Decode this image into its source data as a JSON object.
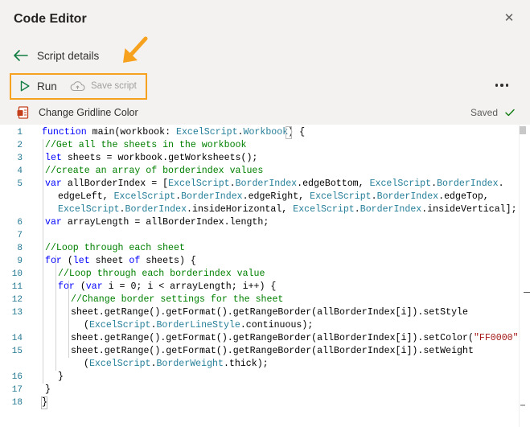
{
  "header": {
    "title": "Code Editor",
    "close_icon": "close-icon"
  },
  "nav": {
    "back_label": "Script details",
    "back_icon": "arrow-left-icon"
  },
  "toolbar": {
    "run_label": "Run",
    "run_icon": "play-icon",
    "save_label": "Save script",
    "save_icon": "cloud-icon",
    "more_icon": "more-horizontal-icon",
    "highlight_color": "#f6a21e"
  },
  "file": {
    "name": "Change Gridline Color",
    "icon": "script-file-icon",
    "status": "Saved",
    "status_icon": "checkmark-icon"
  },
  "colors": {
    "keyword": "#0000ff",
    "comment": "#008000",
    "type": "#267f99",
    "string": "#a31515",
    "line_number": "#237893",
    "check": "#107c10",
    "file_icon": "#c43e1c"
  },
  "editor": {
    "line_numbers": [
      "1",
      "2",
      "3",
      "4",
      "5",
      "",
      "",
      "6",
      "7",
      "8",
      "9",
      "10",
      "11",
      "12",
      "13",
      "",
      "14",
      "15",
      "",
      "16",
      "17",
      "18"
    ],
    "lines": [
      [
        [
          "k",
          "function"
        ],
        [
          "p",
          " main(workbook: "
        ],
        [
          "t",
          "ExcelScript"
        ],
        [
          "p",
          "."
        ],
        [
          "t",
          "Workbook"
        ],
        [
          "p",
          ") {"
        ]
      ],
      [
        [
          "c",
          "//Get all the sheets in the workbook"
        ]
      ],
      [
        [
          "k",
          "let"
        ],
        [
          "p",
          " sheets = workbook.getWorksheets();"
        ]
      ],
      [
        [
          "c",
          "//create an array of borderindex values"
        ]
      ],
      [
        [
          "k",
          "var"
        ],
        [
          "p",
          " allBorderIndex = ["
        ],
        [
          "t",
          "ExcelScript"
        ],
        [
          "p",
          "."
        ],
        [
          "t",
          "BorderIndex"
        ],
        [
          "p",
          ".edgeBottom, "
        ],
        [
          "t",
          "ExcelScript"
        ],
        [
          "p",
          "."
        ],
        [
          "t",
          "BorderIndex"
        ],
        [
          "p",
          "."
        ]
      ],
      [
        [
          "p",
          "edgeLeft, "
        ],
        [
          "t",
          "ExcelScript"
        ],
        [
          "p",
          "."
        ],
        [
          "t",
          "BorderIndex"
        ],
        [
          "p",
          ".edgeRight, "
        ],
        [
          "t",
          "ExcelScript"
        ],
        [
          "p",
          "."
        ],
        [
          "t",
          "BorderIndex"
        ],
        [
          "p",
          ".edgeTop,"
        ]
      ],
      [
        [
          "t",
          "ExcelScript"
        ],
        [
          "p",
          "."
        ],
        [
          "t",
          "BorderIndex"
        ],
        [
          "p",
          ".insideHorizontal, "
        ],
        [
          "t",
          "ExcelScript"
        ],
        [
          "p",
          "."
        ],
        [
          "t",
          "BorderIndex"
        ],
        [
          "p",
          ".insideVertical];"
        ]
      ],
      [
        [
          "k",
          "var"
        ],
        [
          "p",
          " arrayLength = allBorderIndex.length;"
        ]
      ],
      [],
      [
        [
          "c",
          "//Loop through each sheet"
        ]
      ],
      [
        [
          "k",
          "for"
        ],
        [
          "p",
          " ("
        ],
        [
          "k",
          "let"
        ],
        [
          "p",
          " sheet "
        ],
        [
          "k",
          "of"
        ],
        [
          "p",
          " sheets) {"
        ]
      ],
      [
        [
          "c",
          "//Loop through each borderindex value"
        ]
      ],
      [
        [
          "k",
          "for"
        ],
        [
          "p",
          " ("
        ],
        [
          "k",
          "var"
        ],
        [
          "p",
          " i = 0; i < arrayLength; i++) {"
        ]
      ],
      [
        [
          "c",
          "//Change border settings for the sheet"
        ]
      ],
      [
        [
          "p",
          "sheet.getRange().getFormat().getRangeBorder(allBorderIndex[i]).setStyle"
        ]
      ],
      [
        [
          "p",
          "("
        ],
        [
          "t",
          "ExcelScript"
        ],
        [
          "p",
          "."
        ],
        [
          "t",
          "BorderLineStyle"
        ],
        [
          "p",
          ".continuous);"
        ]
      ],
      [
        [
          "p",
          "sheet.getRange().getFormat().getRangeBorder(allBorderIndex[i]).setColor("
        ],
        [
          "s",
          "\"FF0000\""
        ],
        [
          "p",
          ");"
        ]
      ],
      [
        [
          "p",
          "sheet.getRange().getFormat().getRangeBorder(allBorderIndex[i]).setWeight"
        ]
      ],
      [
        [
          "p",
          "("
        ],
        [
          "t",
          "ExcelScript"
        ],
        [
          "p",
          "."
        ],
        [
          "t",
          "BorderWeight"
        ],
        [
          "p",
          ".thick);"
        ]
      ],
      [
        [
          "p",
          "}"
        ]
      ],
      [
        [
          "p",
          "}"
        ]
      ],
      [
        [
          "p",
          "}"
        ]
      ]
    ]
  }
}
